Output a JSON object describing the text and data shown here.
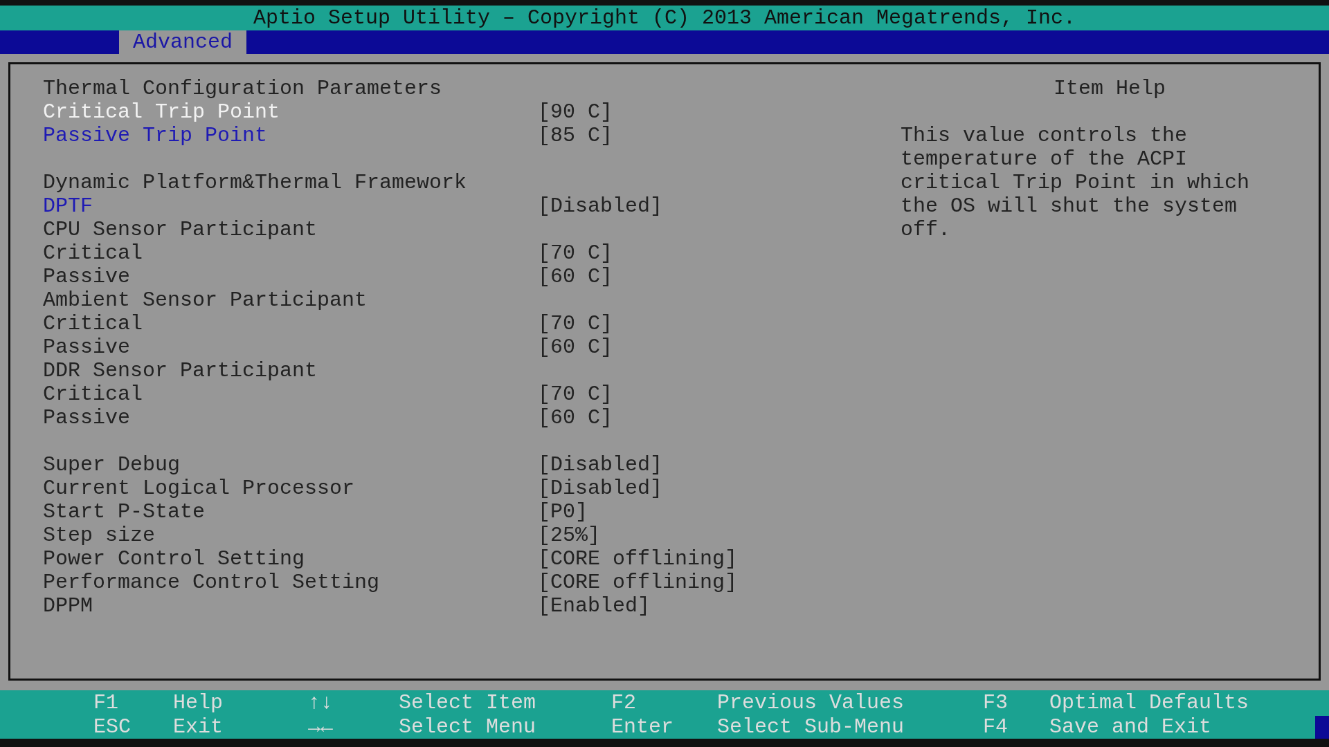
{
  "title": "Aptio Setup Utility – Copyright (C) 2013 American Megatrends, Inc.",
  "tabs": [
    {
      "label": "Advanced",
      "selected": true
    }
  ],
  "items": [
    {
      "kind": "heading",
      "label": "Thermal Configuration Parameters"
    },
    {
      "kind": "setting",
      "label": "Critical Trip Point",
      "value": "[90 C]",
      "selected": true,
      "disabled": false
    },
    {
      "kind": "setting",
      "label": "Passive Trip Point",
      "value": "[85 C]",
      "selected": false,
      "disabled": false
    },
    {
      "kind": "blank"
    },
    {
      "kind": "heading",
      "label": "Dynamic Platform&Thermal Framework"
    },
    {
      "kind": "setting",
      "label": "DPTF",
      "value": "[Disabled]",
      "selected": false,
      "disabled": false
    },
    {
      "kind": "heading",
      "label": "CPU Sensor Participant"
    },
    {
      "kind": "setting",
      "label": "Critical",
      "value": "[70 C]",
      "selected": false,
      "disabled": true
    },
    {
      "kind": "setting",
      "label": "Passive",
      "value": "[60 C]",
      "selected": false,
      "disabled": true
    },
    {
      "kind": "heading",
      "label": "Ambient Sensor Participant"
    },
    {
      "kind": "setting",
      "label": "Critical",
      "value": "[70 C]",
      "selected": false,
      "disabled": true
    },
    {
      "kind": "setting",
      "label": "Passive",
      "value": "[60 C]",
      "selected": false,
      "disabled": true
    },
    {
      "kind": "heading",
      "label": "DDR Sensor Participant"
    },
    {
      "kind": "setting",
      "label": "Critical",
      "value": "[70 C]",
      "selected": false,
      "disabled": true
    },
    {
      "kind": "setting",
      "label": "Passive",
      "value": "[60 C]",
      "selected": false,
      "disabled": true
    },
    {
      "kind": "blank"
    },
    {
      "kind": "setting",
      "label": "Super Debug",
      "value": "[Disabled]",
      "selected": false,
      "disabled": true
    },
    {
      "kind": "setting",
      "label": "Current Logical Processor",
      "value": "[Disabled]",
      "selected": false,
      "disabled": true
    },
    {
      "kind": "setting",
      "label": "Start P-State",
      "value": "[P0]",
      "selected": false,
      "disabled": true
    },
    {
      "kind": "setting",
      "label": "Step size",
      "value": "[25%]",
      "selected": false,
      "disabled": true
    },
    {
      "kind": "setting",
      "label": "Power Control Setting",
      "value": "[CORE offlining]",
      "selected": false,
      "disabled": true
    },
    {
      "kind": "setting",
      "label": "Performance Control Setting",
      "value": "[CORE offlining]",
      "selected": false,
      "disabled": true
    },
    {
      "kind": "setting",
      "label": "DPPM",
      "value": "[Enabled]",
      "selected": false,
      "disabled": true
    }
  ],
  "help": {
    "title": "Item Help",
    "lines": [
      "This value controls the",
      "temperature of the ACPI",
      "critical Trip Point in which",
      "the OS will shut the system",
      "off."
    ]
  },
  "footer": [
    {
      "key": "F1",
      "action": "Help"
    },
    {
      "key": "↑↓",
      "action": "Select Item"
    },
    {
      "key": "F2",
      "action": "Previous Values"
    },
    {
      "key": "F3",
      "action": "Optimal Defaults"
    },
    {
      "key": "ESC",
      "action": "Exit"
    },
    {
      "key": "→←",
      "action": "Select Menu"
    },
    {
      "key": "Enter",
      "action": "Select Sub-Menu"
    },
    {
      "key": "F4",
      "action": "Save and Exit"
    }
  ]
}
